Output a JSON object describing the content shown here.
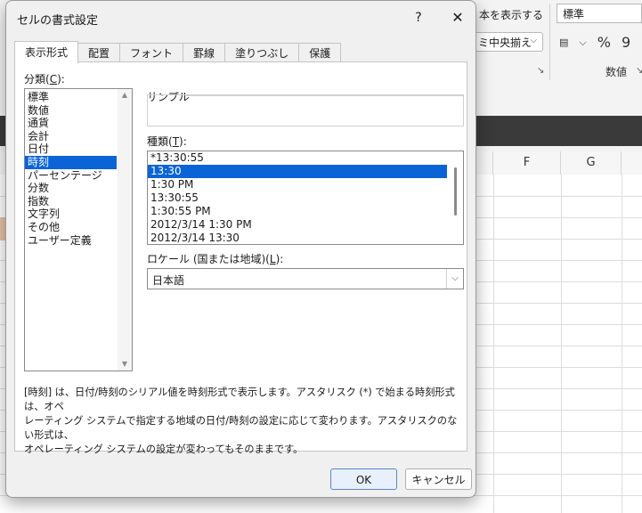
{
  "excel": {
    "ribbon": {
      "wrap_text_label": "本を表示する",
      "align_center_label": "ミ中央揃え",
      "number_format_value": "標準",
      "number_group_label": "数値",
      "currency_icon": "▤",
      "percent_symbol": "%",
      "comma_symbol": "9"
    },
    "columns": [
      "F",
      "G"
    ]
  },
  "dialog": {
    "title": "セルの書式設定",
    "help": "?",
    "close": "✕",
    "tabs": [
      "表示形式",
      "配置",
      "フォント",
      "罫線",
      "塗りつぶし",
      "保護"
    ],
    "category_label_prefix": "分類(",
    "category_label_key": "C",
    "category_label_suffix": "):",
    "categories": [
      "標準",
      "数値",
      "通貨",
      "会計",
      "日付",
      "時刻",
      "パーセンテージ",
      "分数",
      "指数",
      "文字列",
      "その他",
      "ユーザー定義"
    ],
    "sample_label": "サンプル",
    "type_label_prefix": "種類(",
    "type_label_key": "T",
    "type_label_suffix": "):",
    "types": [
      "*13:30:55",
      "13:30",
      "1:30 PM",
      "13:30:55",
      "1:30:55 PM",
      "2012/3/14 1:30 PM",
      "2012/3/14 13:30"
    ],
    "locale_label_prefix": "ロケール (国または地域)(",
    "locale_label_key": "L",
    "locale_label_suffix": "):",
    "locale_value": "日本語",
    "description_line1": "[時刻] は、日付/時刻のシリアル値を時刻形式で表示します。アスタリスク (*) で始まる時刻形式は、オペ",
    "description_line2": "レーティング システムで指定する地域の日付/時刻の設定に応じて変わります。アスタリスクのない形式は、",
    "description_line3": "オペレーティング システムの設定が変わってもそのままです。",
    "ok_label": "OK",
    "cancel_label": "キャンセル"
  }
}
